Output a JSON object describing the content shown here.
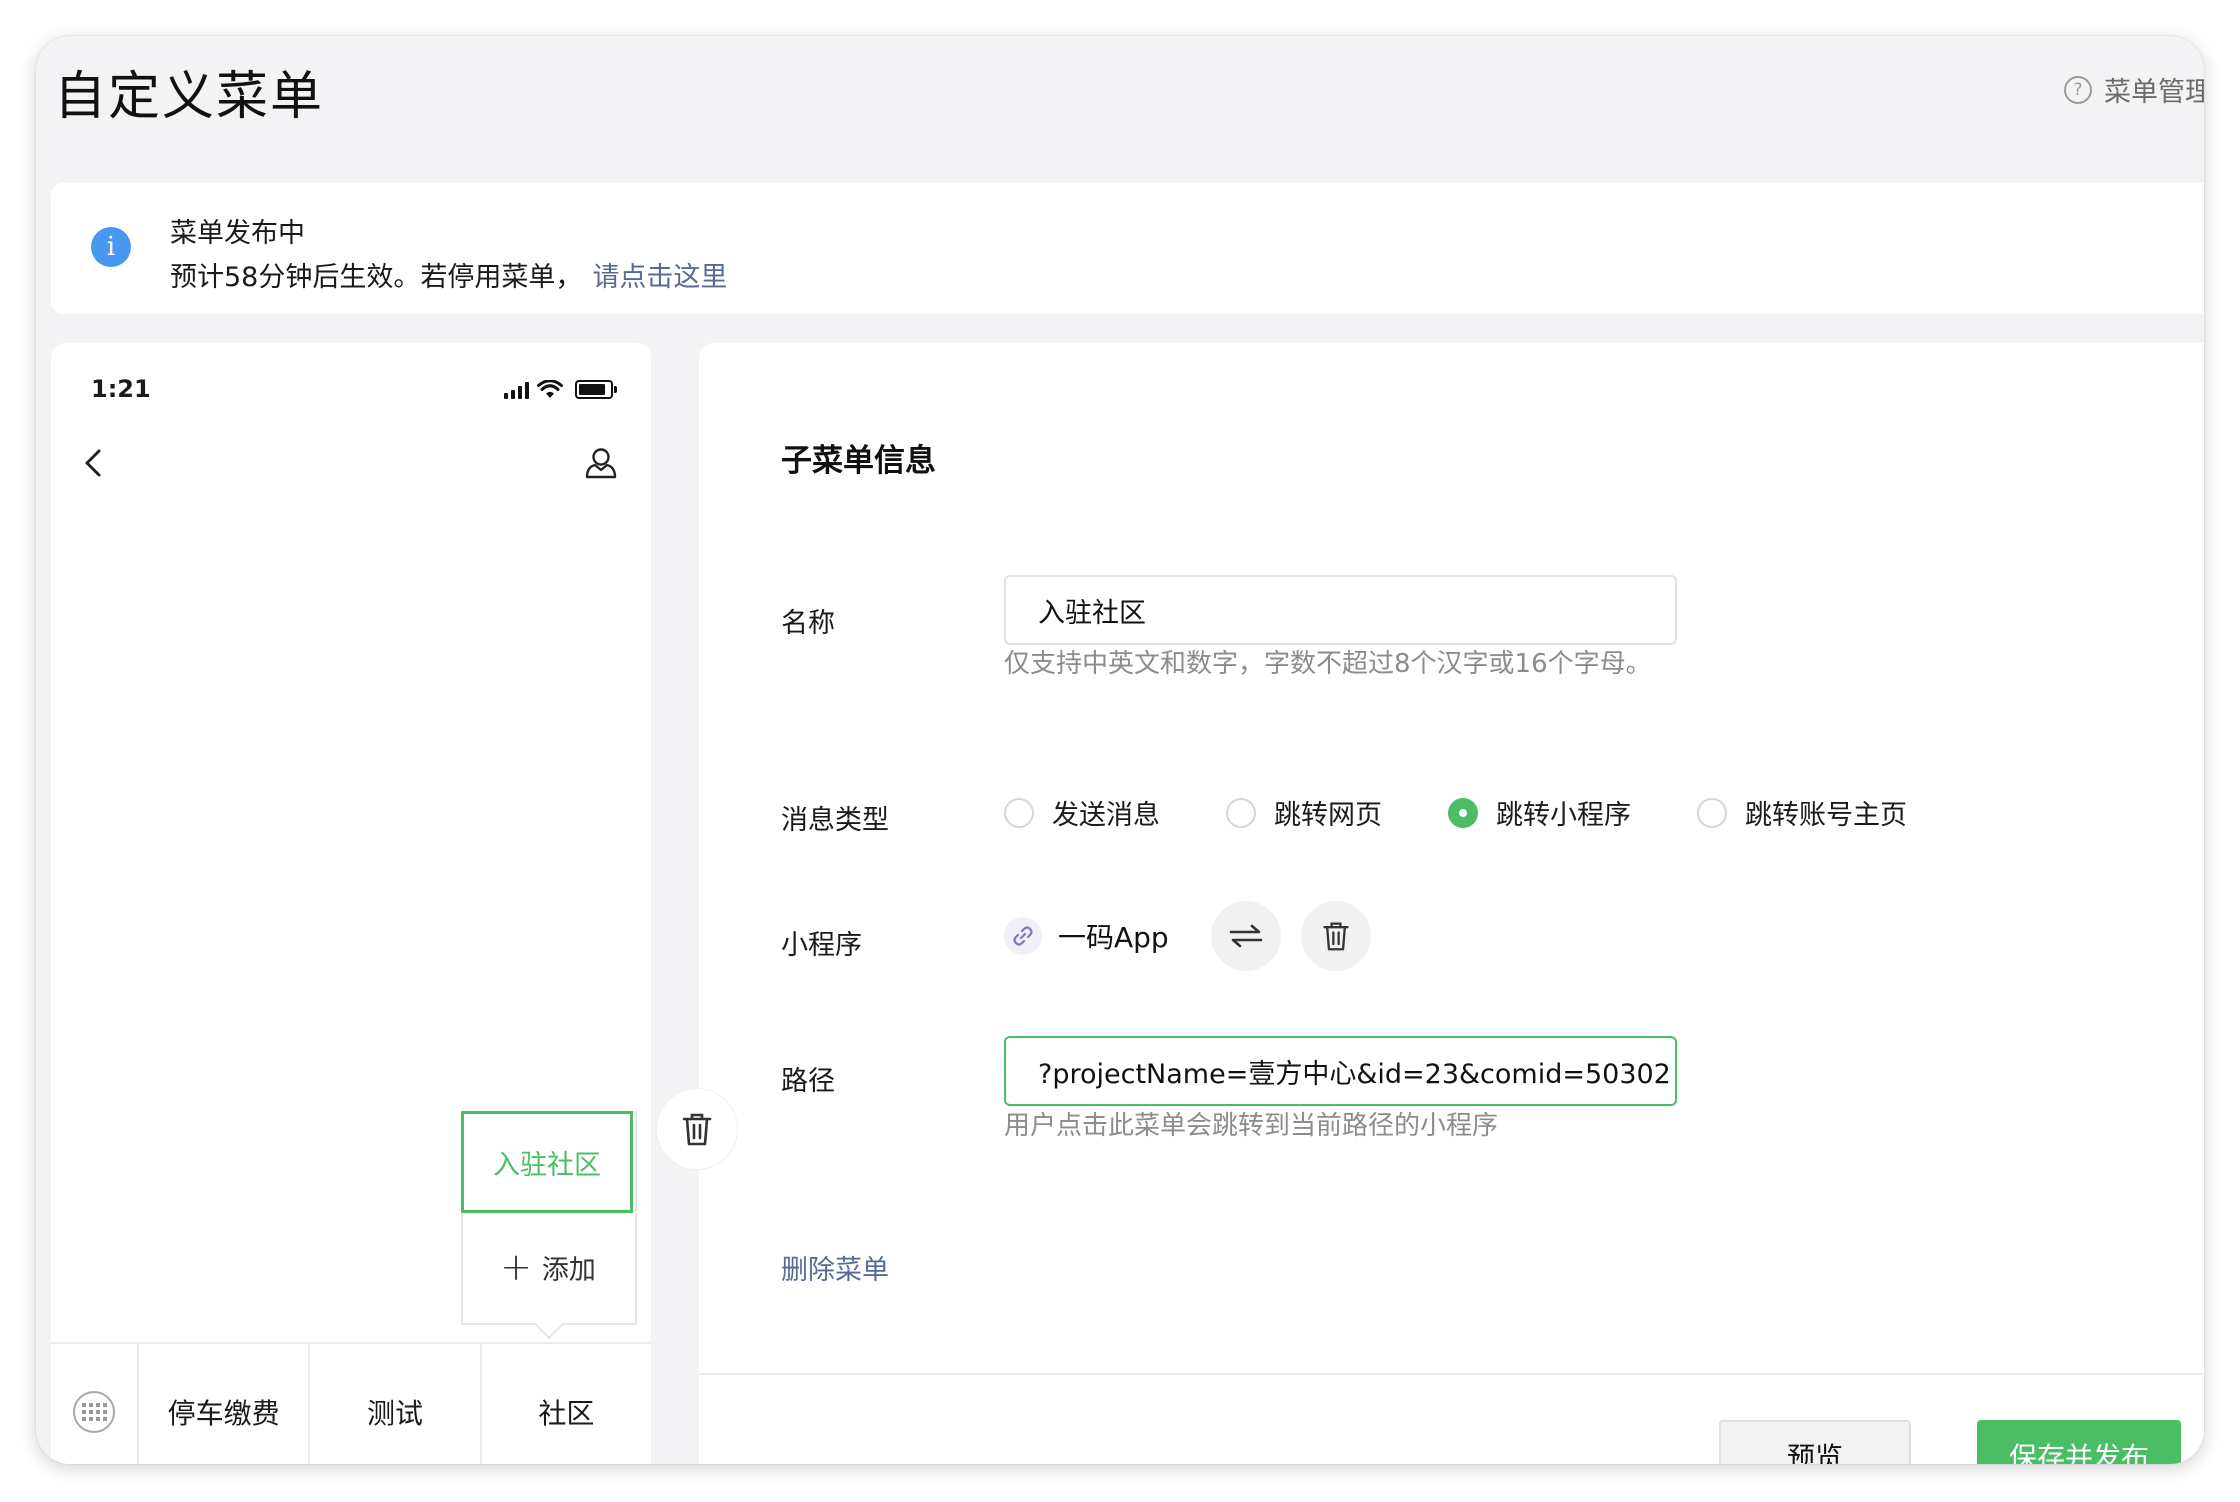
{
  "page": {
    "title": "自定义菜单",
    "help_label": "菜单管理"
  },
  "notice": {
    "title": "菜单发布中",
    "desc": "预计58分钟后生效。若停用菜单，",
    "link": "请点击这里"
  },
  "phone": {
    "time": "1:21",
    "popup": {
      "active_item": "入驻社区",
      "add_label": "添加"
    },
    "menu": [
      "停车缴费",
      "测试",
      "社区"
    ]
  },
  "panel": {
    "section_title": "子菜单信息",
    "name": {
      "label": "名称",
      "value": "入驻社区",
      "hint": "仅支持中英文和数字，字数不超过8个汉字或16个字母。"
    },
    "type": {
      "label": "消息类型",
      "options": [
        "发送消息",
        "跳转网页",
        "跳转小程序",
        "跳转账号主页"
      ],
      "selected": "跳转小程序"
    },
    "miniprogram": {
      "label": "小程序",
      "name": "一码App"
    },
    "path": {
      "label": "路径",
      "value": "?projectName=壹方中心&id=23&comid=50302",
      "hint": "用户点击此菜单会跳转到当前路径的小程序"
    },
    "delete_label": "删除菜单",
    "preview_label": "预览",
    "save_label": "保存并发布"
  },
  "colors": {
    "accent_green": "#4bbd65",
    "link_blue": "#576b95",
    "info_blue": "#4a97f0"
  }
}
